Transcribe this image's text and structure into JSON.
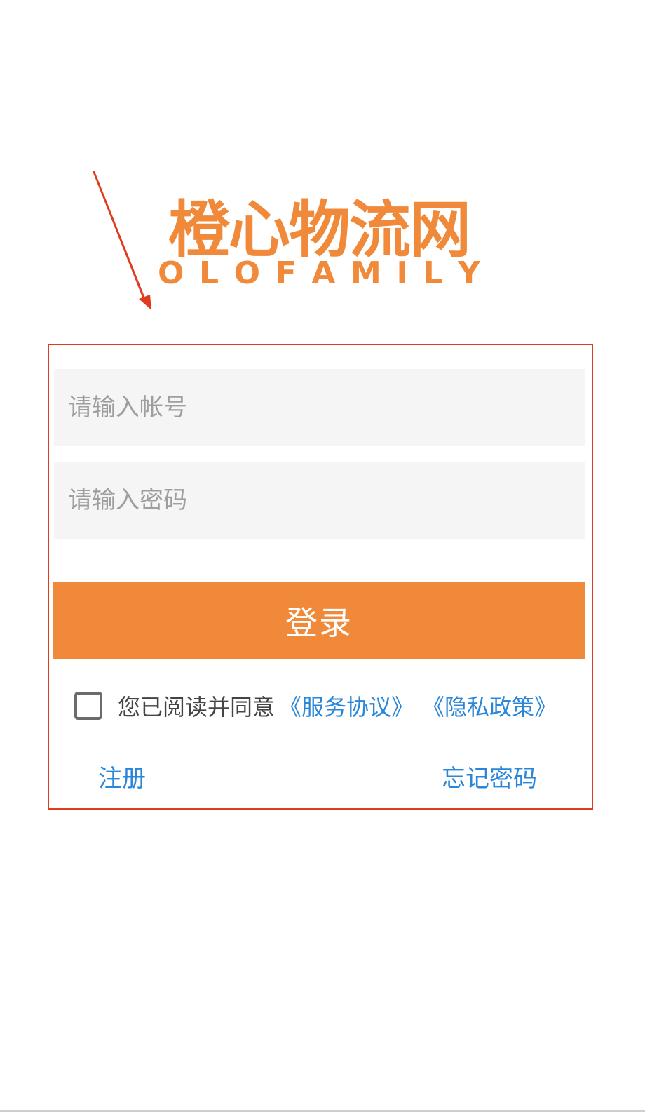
{
  "logo": {
    "name_cn": "橙心物流网",
    "name_en_letters": [
      "O",
      "L",
      "O",
      "F",
      "A",
      "M",
      "I",
      "L",
      "Y"
    ]
  },
  "login_form": {
    "account_placeholder": "请输入帐号",
    "password_placeholder": "请输入密码",
    "login_label": "登录",
    "agreement": {
      "text": "您已阅读并同意",
      "service_link": "《服务协议》",
      "privacy_link": "《隐私政策》",
      "checked": false
    },
    "register_label": "注册",
    "forgot_label": "忘记密码"
  },
  "colors": {
    "accent": "#f08a3a",
    "link": "#2a86d8",
    "annotation": "#e03a1f"
  }
}
